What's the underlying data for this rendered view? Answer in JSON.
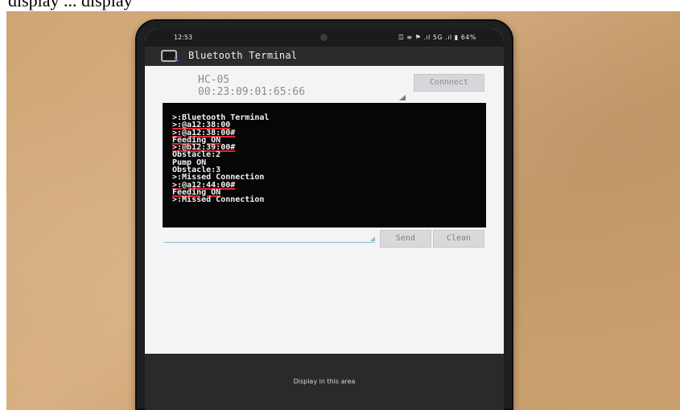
{
  "caption": {
    "text": "display ... display"
  },
  "status_bar": {
    "time": "12:53",
    "icons": "☲ ≡ ⚑ .ıl 5G .ıl ▮ 64%",
    "battery": "64%"
  },
  "app_bar": {
    "title": "Bluetooth Terminal",
    "icon": "bluetooth-terminal-icon"
  },
  "device": {
    "name": "HC-05",
    "mac": "00:23:09:01:65:66"
  },
  "buttons": {
    "connect": "Connnect",
    "send": "Send",
    "clean": "Clean"
  },
  "terminal": {
    "lines": [
      ">:Bluetooth Terminal",
      ">:@a12:38:00",
      ">:@a12:38:00#",
      "Feeding ON",
      ">:@b12:39:00#",
      "Obstacle:2",
      "Pump ON",
      "Obstacle:3",
      ">:Missed Connection",
      ">:@a12:44:00#",
      "Feeding ON",
      ">:Missed Connection"
    ]
  },
  "footer": {
    "text": "Display in this area"
  },
  "colors": {
    "terminal_bg": "#060606",
    "app_bar": "#2b2b2d",
    "table": "#d0a777"
  }
}
